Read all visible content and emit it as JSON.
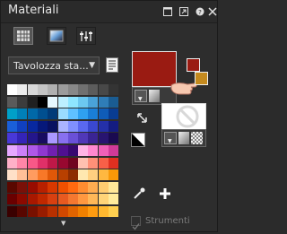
{
  "title": "Materiali",
  "dropdown": {
    "value": "Tavolozza sta..."
  },
  "strumenti_label": "Strumenti",
  "colors": {
    "foreground": "#9a1b12",
    "background": "#ffffff",
    "small_fg": "#9a1b12",
    "small_bg": "#c48a1e"
  },
  "palette": [
    [
      "#ffffff",
      "#ececec",
      "#d8d8d8",
      "#c4c4c4",
      "#b0b0b0",
      "#9c9c9c",
      "#888888",
      "#707070",
      "#5c5c5c",
      "#484848",
      "#343434"
    ],
    [
      "#5a5a5a",
      "#3c3c3c",
      "#202020",
      "#000000",
      "#e6f8ff",
      "#bdefff",
      "#8ee5ff",
      "#6cc8f0",
      "#4aa2d8",
      "#2f7db8",
      "#1a5c92"
    ],
    [
      "#00a0c8",
      "#0080b8",
      "#0068a8",
      "#004f90",
      "#003a78",
      "#9bdcff",
      "#5fc0ff",
      "#2fa0f0",
      "#1a7ed8",
      "#0f5cb8",
      "#083c92"
    ],
    [
      "#1a5fd8",
      "#1040c0",
      "#0828a0",
      "#06187a",
      "#081060",
      "#aab4ff",
      "#8090ff",
      "#5a68f0",
      "#3a48d0",
      "#2430a8",
      "#141c80"
    ],
    [
      "#4838d8",
      "#3424b8",
      "#24168c",
      "#180c60",
      "#aa98ff",
      "#8870f0",
      "#6a50d8",
      "#5038b8",
      "#3a2494",
      "#281470",
      "#1a0a50"
    ],
    [
      "#e6a8ff",
      "#cc80f8",
      "#b058e8",
      "#9038d0",
      "#7020b0",
      "#501090",
      "#380870",
      "#ffb4e6",
      "#ff88d0",
      "#f060b8",
      "#d03a98"
    ],
    [
      "#ffb0c8",
      "#ff86a8",
      "#f85888",
      "#e03068",
      "#c01848",
      "#980830",
      "#700420",
      "#ffc0b0",
      "#ff9078",
      "#f86048",
      "#e03020"
    ],
    [
      "#ffe0c8",
      "#ffc098",
      "#ff9c60",
      "#f87828",
      "#e05808",
      "#b84000",
      "#8c2c00",
      "#ffe8b0",
      "#ffd080",
      "#ffb840",
      "#f89808"
    ],
    [
      "#5a0800",
      "#7a1008",
      "#980c00",
      "#b82000",
      "#d83800",
      "#f05000",
      "#ff6a10",
      "#ff8c30",
      "#ffac50",
      "#ffcc70",
      "#ffe898"
    ],
    [
      "#6a0000",
      "#8c0a00",
      "#a81800",
      "#c02800",
      "#d84010",
      "#e85a20",
      "#f47830",
      "#ff9840",
      "#ffb858",
      "#ffd478",
      "#ffec9c"
    ],
    [
      "#3a0000",
      "#580600",
      "#781000",
      "#981c00",
      "#b83000",
      "#d04800",
      "#e06400",
      "#f08000",
      "#ff9c10",
      "#ffb830",
      "#ffd050"
    ]
  ]
}
